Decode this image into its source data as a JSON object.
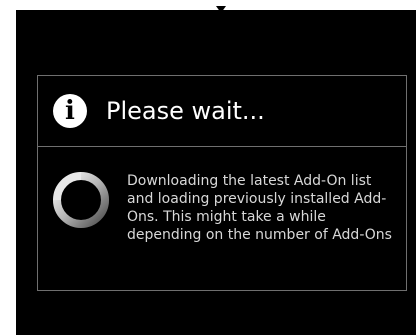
{
  "dialog": {
    "title": "Please wait...",
    "message": "Downloading the latest Add-On list and loading previously installed Add-Ons. This might take a while depending on the number of Add-Ons",
    "icon": "info-icon",
    "spinner_icon": "loading-spinner-icon"
  },
  "colors": {
    "background": "#000000",
    "border": "#6f6f6f",
    "title_text": "#ffffff",
    "message_text": "#d8d8d8"
  }
}
